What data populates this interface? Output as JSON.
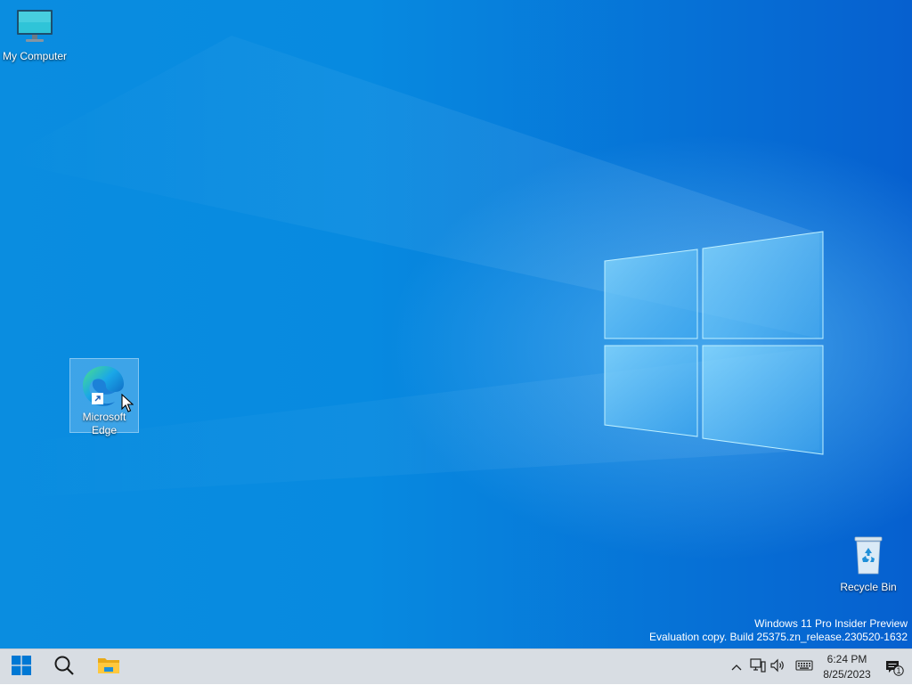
{
  "desktop": {
    "icons": {
      "my_computer": {
        "label": "My Computer",
        "icon": "monitor-icon"
      },
      "edge": {
        "label": "Microsoft Edge",
        "icon": "edge-icon",
        "selected": true
      },
      "recycle_bin": {
        "label": "Recycle Bin",
        "icon": "recycle-bin-icon"
      }
    },
    "watermark": {
      "line1": "Windows 11 Pro Insider Preview",
      "line2": "Evaluation copy. Build 25375.zn_release.230520-1632"
    },
    "colors": {
      "wallpaper_left": "#0a8de0",
      "wallpaper_right": "#0660cf"
    }
  },
  "taskbar": {
    "buttons": [
      {
        "icon": "windows-logo-icon"
      },
      {
        "icon": "search-icon"
      },
      {
        "icon": "file-explorer-icon"
      }
    ],
    "tray": {
      "icons": [
        "chevron-up-icon",
        "network-icon",
        "volume-icon",
        "keyboard-icon"
      ],
      "time": "6:24 PM",
      "date": "8/25/2023",
      "notification_count": "1"
    },
    "colors": {
      "background": "#d8dde3",
      "accent": "#0078d4"
    }
  }
}
